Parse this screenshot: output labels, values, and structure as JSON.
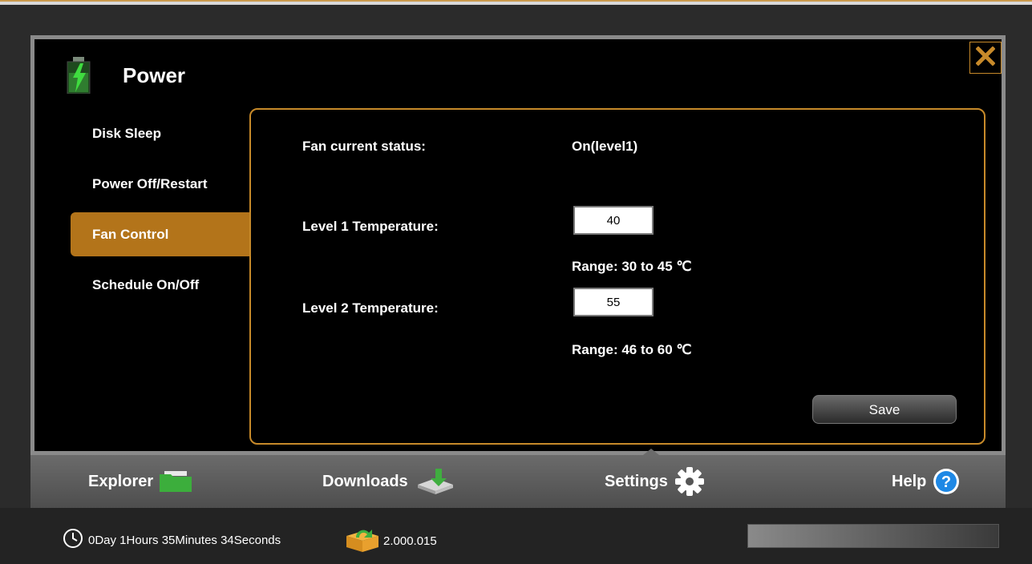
{
  "window": {
    "title": "Power"
  },
  "sidebar": {
    "items": [
      {
        "label": "Disk Sleep",
        "active": false
      },
      {
        "label": "Power Off/Restart",
        "active": false
      },
      {
        "label": "Fan Control",
        "active": true
      },
      {
        "label": "Schedule On/Off",
        "active": false
      }
    ]
  },
  "fan": {
    "status_label": "Fan current status:",
    "status_value": "On(level1)",
    "level1_label": "Level 1 Temperature:",
    "level1_value": "40",
    "level1_range": "Range: 30 to 45 ℃",
    "level2_label": "Level 2 Temperature:",
    "level2_value": "55",
    "level2_range": "Range: 46 to 60 ℃",
    "save_label": "Save"
  },
  "bottom_nav": {
    "explorer": "Explorer",
    "downloads": "Downloads",
    "settings": "Settings",
    "help": "Help"
  },
  "status": {
    "uptime": "0Day 1Hours 35Minutes 34Seconds",
    "version": "2.000.015",
    "progress": 0.0
  },
  "colors": {
    "accent": "#c78a2a",
    "active_nav": "#b3741a",
    "help_icon": "#1e88e5",
    "explorer_icon": "#3cae3c"
  },
  "icons": {
    "title": "battery-power-icon",
    "close": "close-icon",
    "explorer": "folder-icon",
    "downloads": "download-drive-icon",
    "settings": "gear-icon",
    "help": "help-icon",
    "uptime": "clock-icon",
    "version": "update-box-icon"
  }
}
